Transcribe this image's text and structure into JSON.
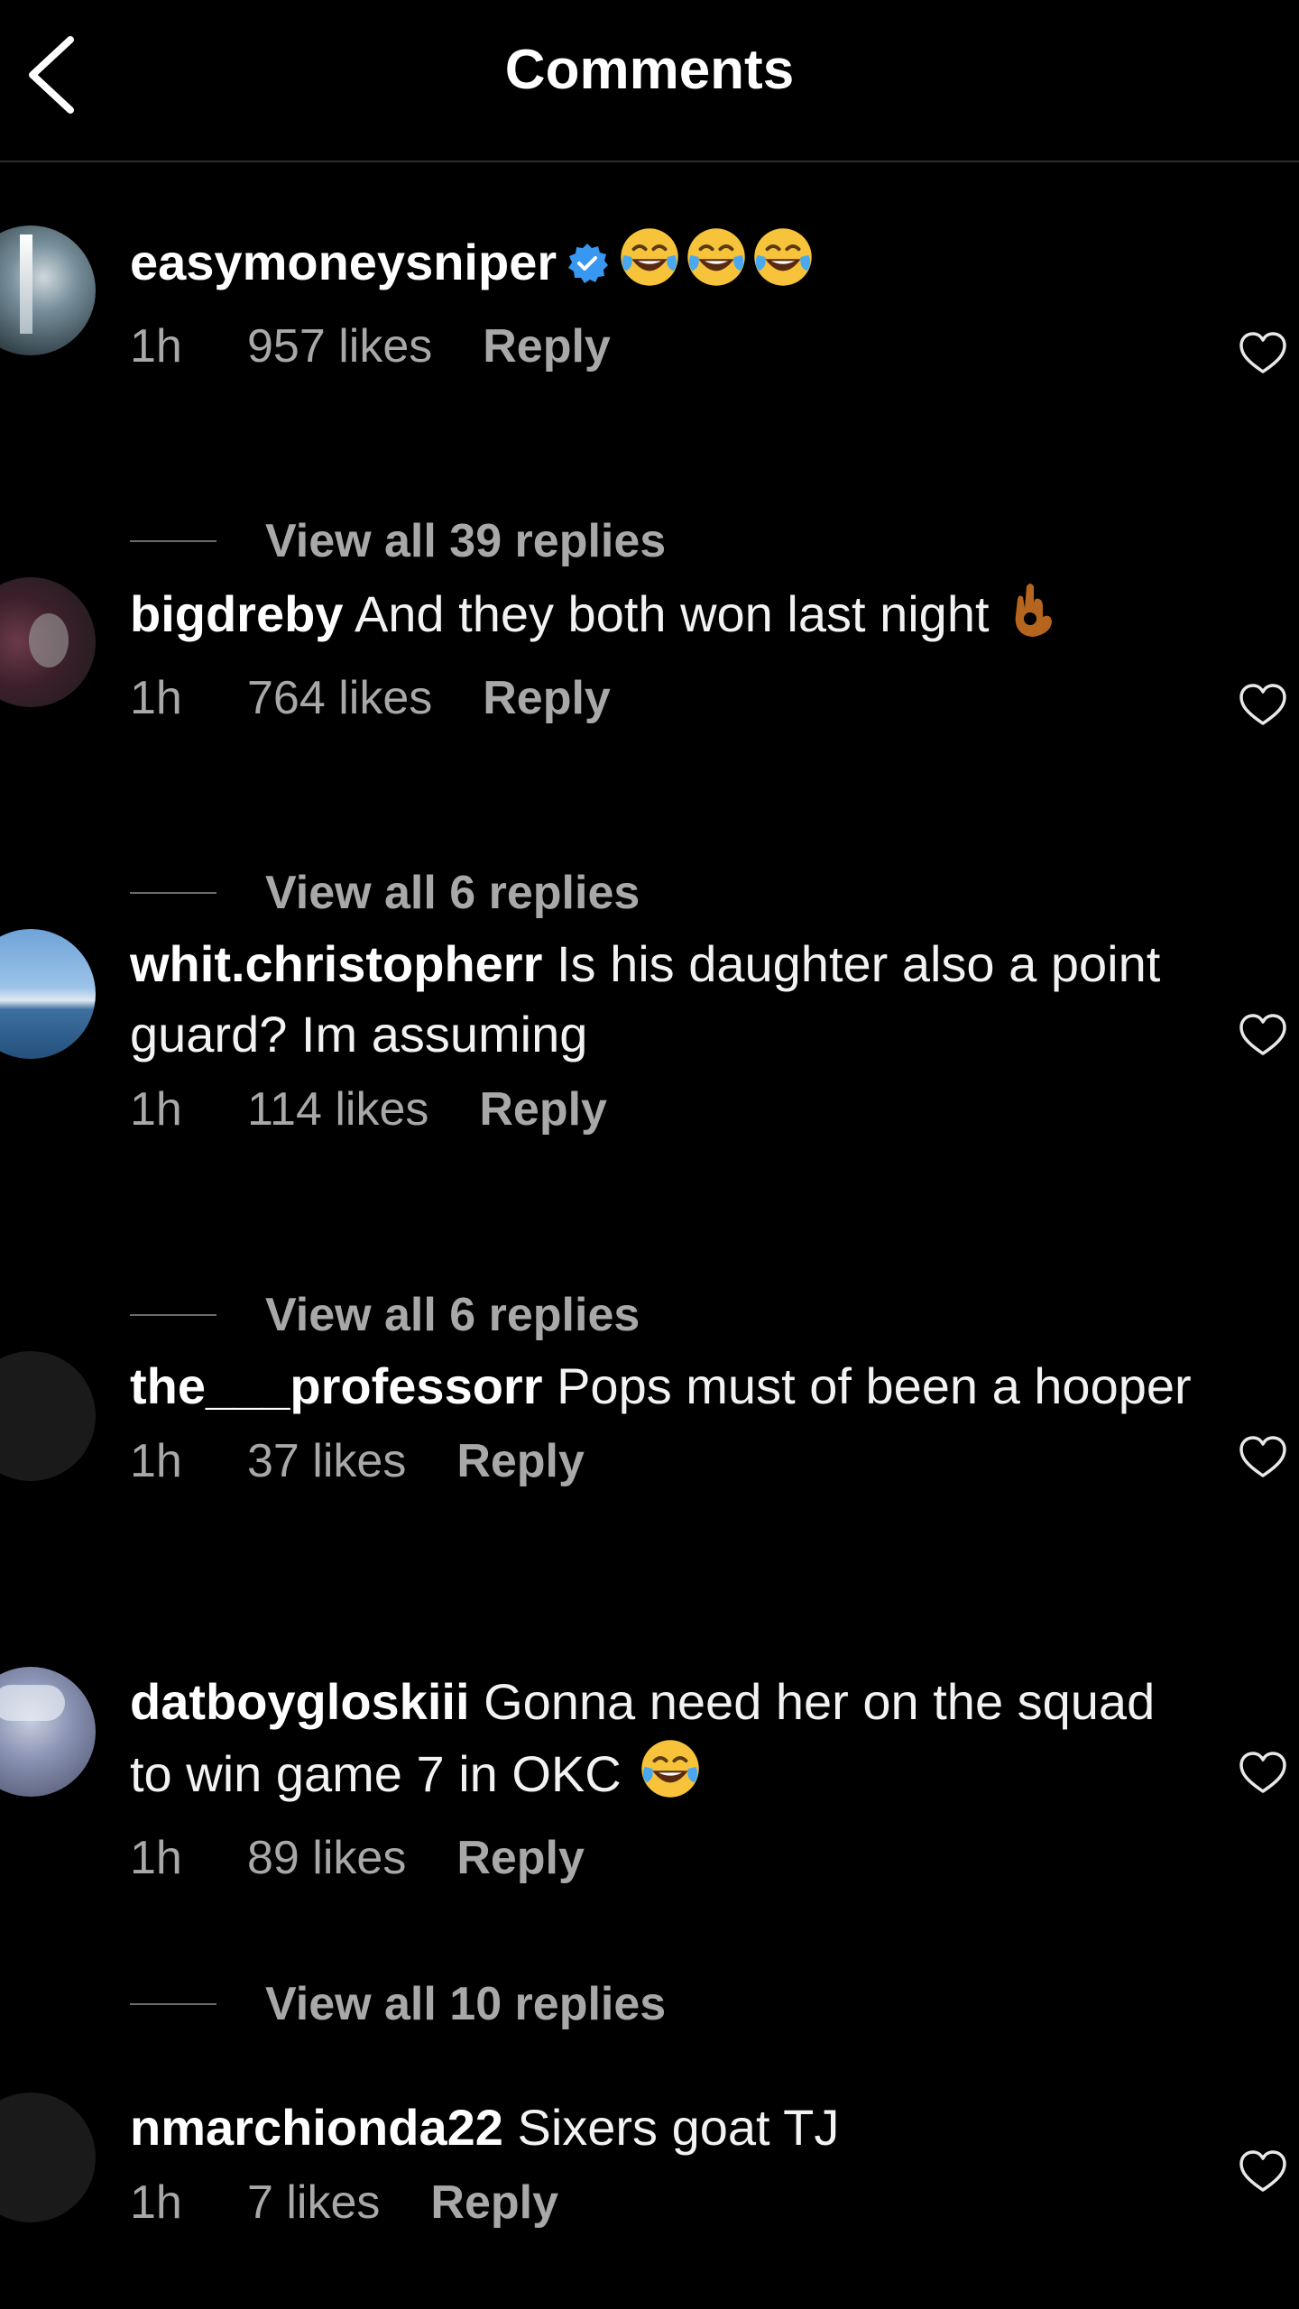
{
  "header": {
    "title": "Comments"
  },
  "comments": [
    {
      "username": "easymoneysniper",
      "verified": true,
      "text": "",
      "emoji_count": 3,
      "time": "1h",
      "likes": "957 likes",
      "reply_label": "Reply",
      "view_replies": "View all 39 replies"
    },
    {
      "username": "bigdreby",
      "text": "And they both won last night",
      "time": "1h",
      "likes": "764 likes",
      "reply_label": "Reply",
      "view_replies": "View all 6 replies"
    },
    {
      "username": "whit.christopherr",
      "text": "Is his daughter also a point guard? Im assuming",
      "time": "1h",
      "likes": "114 likes",
      "reply_label": "Reply",
      "view_replies": "View all 6 replies"
    },
    {
      "username": "the___professorr",
      "text": "Pops must of been a hooper",
      "time": "1h",
      "likes": "37 likes",
      "reply_label": "Reply"
    },
    {
      "username": "datboygloskiii",
      "text": "Gonna need her on the squad to win game 7 in OKC",
      "time": "1h",
      "likes": "89 likes",
      "reply_label": "Reply",
      "view_replies": "View all 10 replies"
    },
    {
      "username": "nmarchionda22",
      "text": "Sixers goat TJ",
      "time": "1h",
      "likes": "7 likes",
      "reply_label": "Reply"
    }
  ],
  "icons": {
    "back": "chevron-left-icon",
    "like": "heart-outline-icon",
    "verified": "verified-badge-icon",
    "laughing": "face-with-tears-of-joy-emoji",
    "ok_hand": "ok-hand-emoji"
  },
  "colors": {
    "background": "#000000",
    "text": "#f5f5f5",
    "muted": "#a8a8a8",
    "verified": "#3897f0"
  }
}
